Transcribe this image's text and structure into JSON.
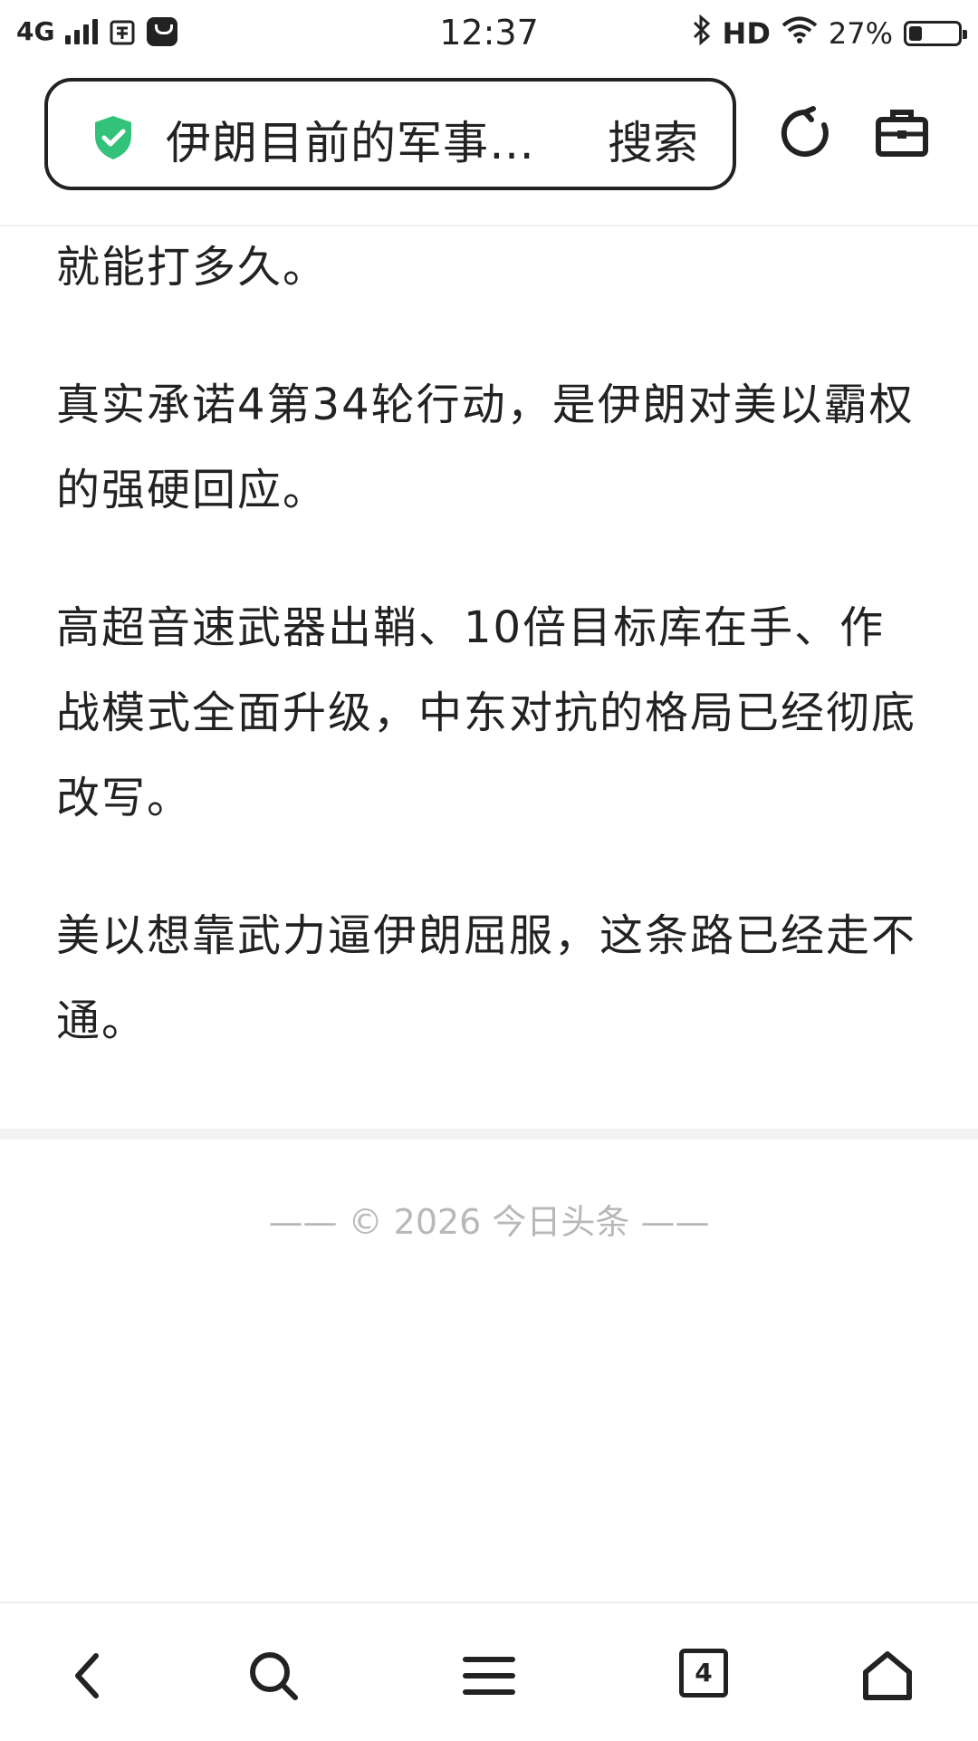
{
  "status_bar": {
    "network": "4G",
    "time": "12:37",
    "hd": "HD",
    "battery_percent": "27%",
    "battery_level": 0.27,
    "icons": [
      "signal-icon",
      "sim-icon",
      "app-notification-icon",
      "bluetooth-icon",
      "wifi-icon",
      "battery-icon"
    ]
  },
  "search_bar": {
    "query": "伊朗目前的军事…",
    "search_label": "搜索",
    "icons": [
      "shield-check-icon",
      "refresh-icon",
      "toolbox-icon"
    ]
  },
  "article": {
    "paragraphs": [
      "就能打多久。",
      "真实承诺4第34轮行动，是伊朗对美以霸权的强硬回应。",
      "高超音速武器出鞘、10倍目标库在手、作战模式全面升级，中东对抗的格局已经彻底改写。",
      "美以想靠武力逼伊朗屈服，这条路已经走不通。"
    ]
  },
  "footer": {
    "copyright": "—— © 2026 今日头条 ——"
  },
  "bottom_nav": {
    "tab_count": "4",
    "icons": [
      "back-icon",
      "search-icon",
      "menu-icon",
      "tabs-icon",
      "home-icon"
    ]
  },
  "colors": {
    "shield_green": "#33c27a",
    "text": "#222222",
    "muted": "#b8b8b8"
  }
}
